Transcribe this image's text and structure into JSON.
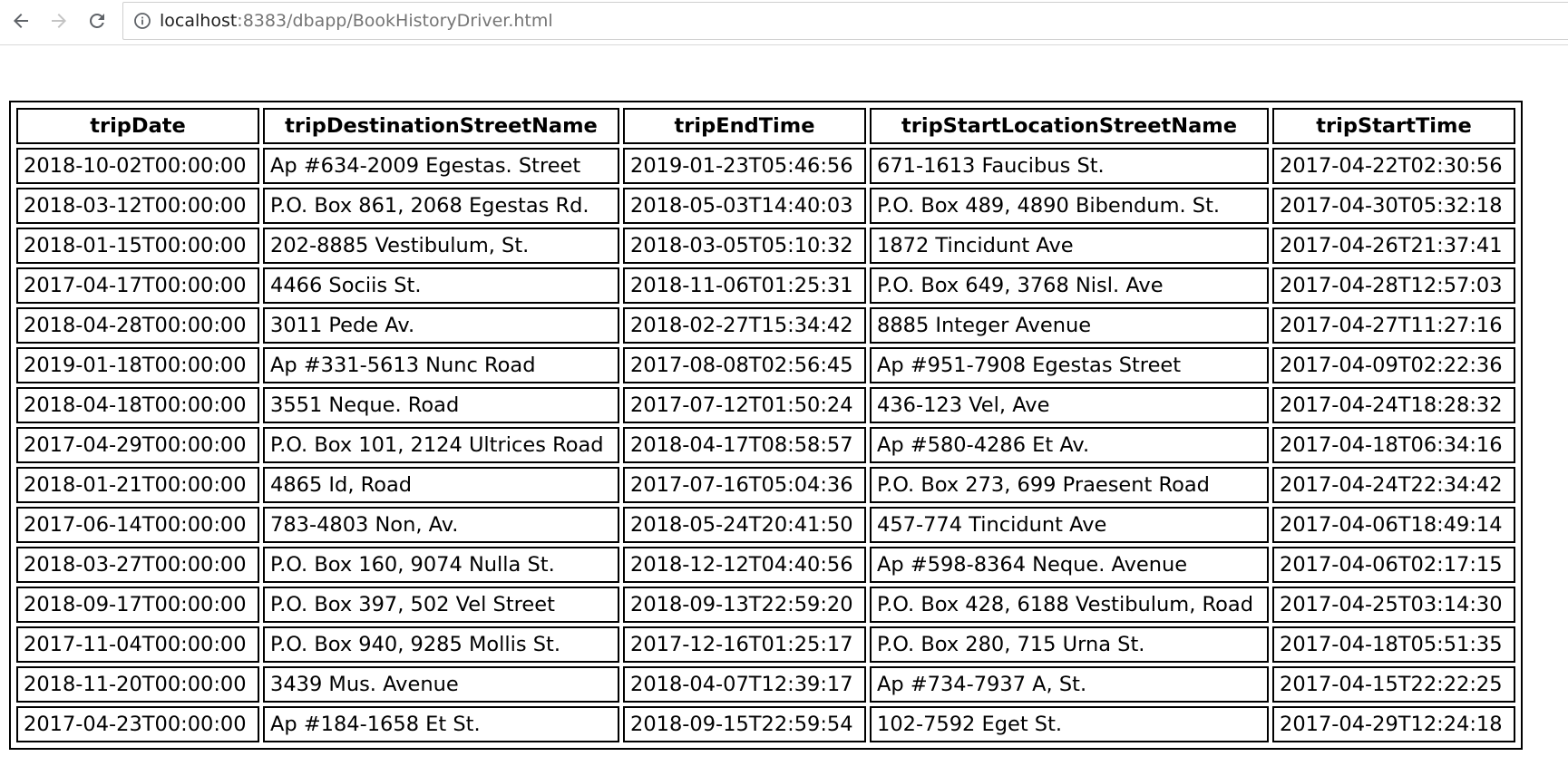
{
  "browser": {
    "url_host": "localhost",
    "url_rest": ":8383/dbapp/BookHistoryDriver.html"
  },
  "table": {
    "headers": [
      "tripDate",
      "tripDestinationStreetName",
      "tripEndTime",
      "tripStartLocationStreetName",
      "tripStartTime"
    ],
    "rows": [
      [
        "2018-10-02T00:00:00",
        "Ap #634-2009 Egestas. Street",
        "2019-01-23T05:46:56",
        "671-1613 Faucibus St.",
        "2017-04-22T02:30:56"
      ],
      [
        "2018-03-12T00:00:00",
        "P.O. Box 861, 2068 Egestas Rd.",
        "2018-05-03T14:40:03",
        "P.O. Box 489, 4890 Bibendum. St.",
        "2017-04-30T05:32:18"
      ],
      [
        "2018-01-15T00:00:00",
        "202-8885 Vestibulum, St.",
        "2018-03-05T05:10:32",
        "1872 Tincidunt Ave",
        "2017-04-26T21:37:41"
      ],
      [
        "2017-04-17T00:00:00",
        "4466 Sociis St.",
        "2018-11-06T01:25:31",
        "P.O. Box 649, 3768 Nisl. Ave",
        "2017-04-28T12:57:03"
      ],
      [
        "2018-04-28T00:00:00",
        "3011 Pede Av.",
        "2018-02-27T15:34:42",
        "8885 Integer Avenue",
        "2017-04-27T11:27:16"
      ],
      [
        "2019-01-18T00:00:00",
        "Ap #331-5613 Nunc Road",
        "2017-08-08T02:56:45",
        "Ap #951-7908 Egestas Street",
        "2017-04-09T02:22:36"
      ],
      [
        "2018-04-18T00:00:00",
        "3551 Neque. Road",
        "2017-07-12T01:50:24",
        "436-123 Vel, Ave",
        "2017-04-24T18:28:32"
      ],
      [
        "2017-04-29T00:00:00",
        "P.O. Box 101, 2124 Ultrices Road",
        "2018-04-17T08:58:57",
        "Ap #580-4286 Et Av.",
        "2017-04-18T06:34:16"
      ],
      [
        "2018-01-21T00:00:00",
        "4865 Id, Road",
        "2017-07-16T05:04:36",
        "P.O. Box 273, 699 Praesent Road",
        "2017-04-24T22:34:42"
      ],
      [
        "2017-06-14T00:00:00",
        "783-4803 Non, Av.",
        "2018-05-24T20:41:50",
        "457-774 Tincidunt Ave",
        "2017-04-06T18:49:14"
      ],
      [
        "2018-03-27T00:00:00",
        "P.O. Box 160, 9074 Nulla St.",
        "2018-12-12T04:40:56",
        "Ap #598-8364 Neque. Avenue",
        "2017-04-06T02:17:15"
      ],
      [
        "2018-09-17T00:00:00",
        "P.O. Box 397, 502 Vel Street",
        "2018-09-13T22:59:20",
        "P.O. Box 428, 6188 Vestibulum, Road",
        "2017-04-25T03:14:30"
      ],
      [
        "2017-11-04T00:00:00",
        "P.O. Box 940, 9285 Mollis St.",
        "2017-12-16T01:25:17",
        "P.O. Box 280, 715 Urna St.",
        "2017-04-18T05:51:35"
      ],
      [
        "2018-11-20T00:00:00",
        "3439 Mus. Avenue",
        "2018-04-07T12:39:17",
        "Ap #734-7937 A, St.",
        "2017-04-15T22:22:25"
      ],
      [
        "2017-04-23T00:00:00",
        "Ap #184-1658 Et St.",
        "2018-09-15T22:59:54",
        "102-7592 Eget St.",
        "2017-04-29T12:24:18"
      ]
    ]
  }
}
